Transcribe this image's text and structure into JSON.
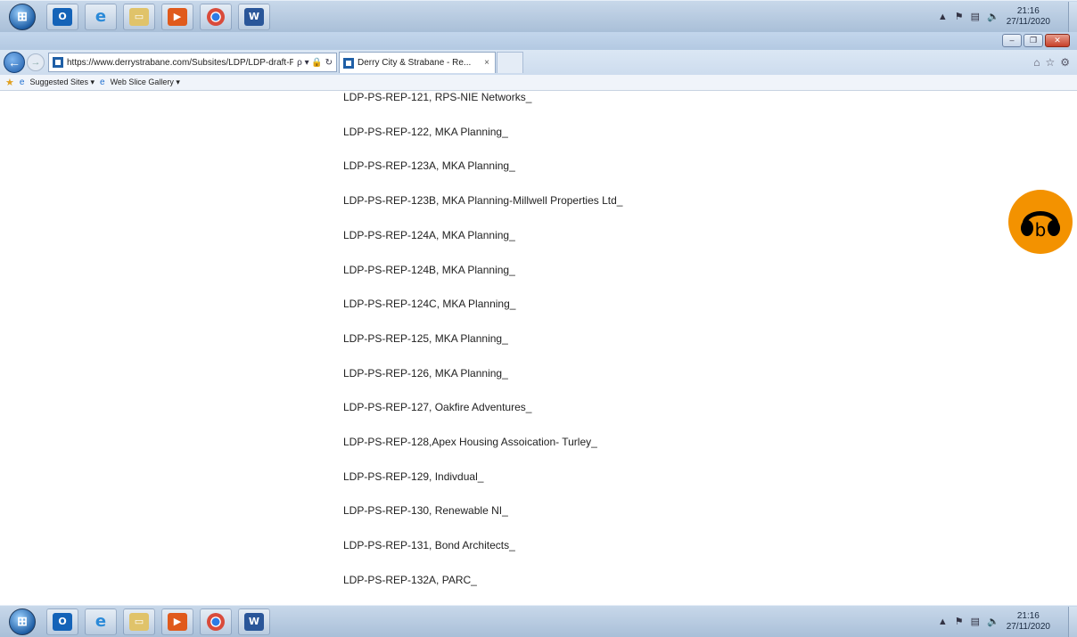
{
  "taskbar": {
    "apps": [
      {
        "name": "outlook-icon",
        "glyph": "O",
        "color": "#1463b8"
      },
      {
        "name": "internet-explorer-icon",
        "glyph": "e",
        "color": "#2b8ad8"
      },
      {
        "name": "file-explorer-icon",
        "glyph": "▭",
        "color": "#d8b54a"
      },
      {
        "name": "media-player-icon",
        "glyph": "▶",
        "color": "#e05a1c"
      },
      {
        "name": "chrome-icon",
        "glyph": "●",
        "color": "#d94b3b"
      },
      {
        "name": "word-icon",
        "glyph": "W",
        "color": "#2a5699"
      }
    ],
    "time": "21:16",
    "date": "27/11/2020"
  },
  "browser": {
    "url": "https://www.derrystrabane.com/Subsites/LDP/LDP-draft-Plar",
    "url_tools": "ρ ▾ 🔒 ↻",
    "tab_title": "Derry City & Strabane - Re...",
    "tab_close": "×",
    "right_icons": [
      "⌂",
      "☆",
      "⚙"
    ]
  },
  "favorites": {
    "suggested_sites": "Suggested Sites ▾",
    "web_slice_gallery": "Web Slice Gallery ▾"
  },
  "documents": [
    "LDP-PS-REP-121, RPS-NIE Networks_",
    "LDP-PS-REP-122, MKA Planning_",
    "LDP-PS-REP-123A, MKA Planning_",
    "LDP-PS-REP-123B, MKA Planning-Millwell Properties Ltd_",
    "LDP-PS-REP-124A, MKA Planning_",
    "LDP-PS-REP-124B, MKA Planning_",
    "LDP-PS-REP-124C, MKA Planning_",
    "LDP-PS-REP-125, MKA Planning_",
    "LDP-PS-REP-126, MKA Planning_",
    "LDP-PS-REP-127, Oakfire Adventures_",
    "LDP-PS-REP-128,Apex Housing Assoication- Turley_",
    "LDP-PS-REP-129, Indivdual_",
    "LDP-PS-REP-130, Renewable NI_",
    "LDP-PS-REP-131, Bond Architects_",
    "LDP-PS-REP-132A, PARC_"
  ]
}
